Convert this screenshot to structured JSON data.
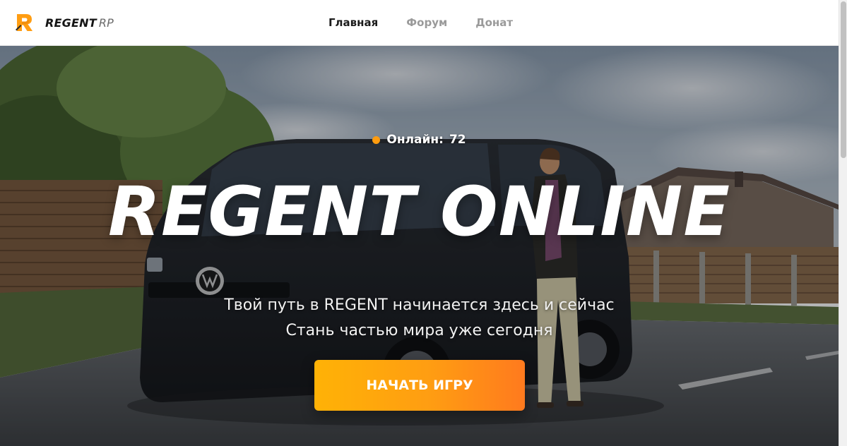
{
  "header": {
    "logo": {
      "brand": "REGENT",
      "suffix": "RP",
      "icon": "regent-r-logo-icon",
      "accent_color": "#ff9d12"
    },
    "nav": [
      {
        "label": "Главная",
        "active": true
      },
      {
        "label": "Форум",
        "active": false
      },
      {
        "label": "Донат",
        "active": false
      }
    ]
  },
  "hero": {
    "online_label": "Онлайн:",
    "online_count": "72",
    "online_indicator_color": "#ff9c0f",
    "title": "REGENT ONLINE",
    "subtitle_line1": "Твой путь в REGENT начинается здесь и сейчас",
    "subtitle_line2": "Стань частью мира уже сегодня",
    "cta_label": "НАЧАТЬ ИГРУ",
    "cta_gradient": [
      "#ffb206",
      "#ff7a1e"
    ],
    "background_image": "street-scene-black-van-man-smoking"
  }
}
